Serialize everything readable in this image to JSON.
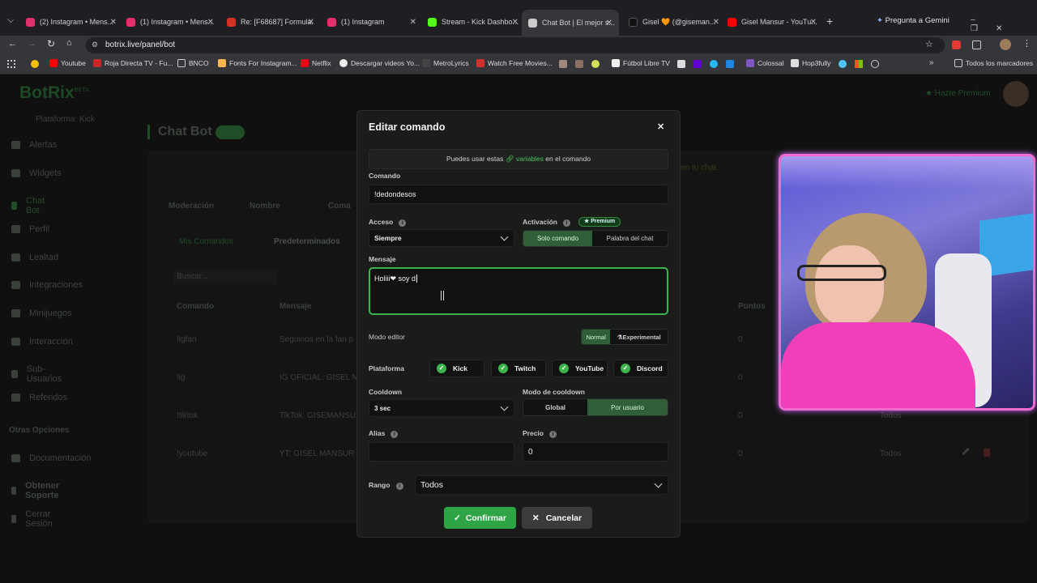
{
  "browser": {
    "tabs": [
      {
        "label": "(2) Instagram • Mens...",
        "color": "#e1306c"
      },
      {
        "label": "(1) Instagram • Mens...",
        "color": "#e1306c"
      },
      {
        "label": "Re: [F68687] Formula...",
        "color": "#d93025"
      },
      {
        "label": "(1) Instagram",
        "color": "#e1306c"
      },
      {
        "label": "Stream - Kick Dashbo...",
        "color": "#53fc18"
      },
      {
        "label": "Chat Bot | El mejor s...",
        "color": "#cccccc"
      },
      {
        "label": "Gisel 🧡 (@giseman...",
        "color": "#111111"
      },
      {
        "label": "Gisel Mansur - YouTu...",
        "color": "#ff0000"
      }
    ],
    "gemini": "Pregunta a Gemini",
    "url": "botrix.live/panel/bot",
    "bookmarks": [
      "Youtube",
      "Roja Directa TV - Fu...",
      "BNCO",
      "Fonts For Instagram...",
      "Netflix",
      "Descargar videos Yo...",
      "MetroLyrics",
      "Watch Free Movies...",
      "Fútbol Libre TV",
      "Colossal",
      "Hop3fully",
      "Todos los marcadores"
    ]
  },
  "app": {
    "logo": "BotRix",
    "beta": "BETA",
    "platform": "Plataforma: Kick",
    "premium": "Hazte Premium",
    "page_title": "Chat Bot",
    "sidebar": [
      "Alertas",
      "Widgets",
      "Chat Bot",
      "Perfil",
      "Lealtad",
      "Integraciones",
      "Minijuegos",
      "Interacción",
      "Sub-Usuarios",
      "Referidos"
    ],
    "otras": "Otras Opciones",
    "sidebar2": [
      "Documentación",
      "Obtener Soporte",
      "Cerrar Sesión"
    ],
    "tabs": [
      "Moderación",
      "Nombre",
      "Coma"
    ],
    "subtabs": [
      "Mis Comandos",
      "Predeterminados"
    ],
    "search": "Buscar...",
    "cols": [
      "Comando",
      "Mensaje",
      "Puntos"
    ],
    "rows": [
      {
        "cmd": "!lgfan",
        "msg": "Seguinos en la fan p",
        "pts": "0"
      },
      {
        "cmd": "!ig",
        "msg": "IG OFICIAL: GISEL M",
        "pts": "0"
      },
      {
        "cmd": "!tiktok",
        "msg": "TikTok: GISEMANSU",
        "pts": "0",
        "rank": "Todos"
      },
      {
        "cmd": "!youtube",
        "msg": "YT: GISEL MANSUR",
        "pts": "0",
        "rank": "Todos"
      }
    ],
    "hint": "en tu chat."
  },
  "modal": {
    "title": "Editar comando",
    "vars_pre": "Puedes usar estas",
    "vars_link": "variables",
    "vars_post": "en el comando",
    "comando_label": "Comando",
    "comando_value": "!dedondesos",
    "acceso_label": "Acceso",
    "acceso_value": "Siempre",
    "activacion_label": "Activación",
    "premium_badge": "Premium",
    "activacion_opts": [
      "Solo comando",
      "Palabra del chat"
    ],
    "mensaje_label": "Mensaje",
    "mensaje_value": "Holiii❤ soy d",
    "modo_label": "Modo editor",
    "modo_opts": [
      "Normal",
      "Experimental"
    ],
    "plataforma_label": "Plataforma",
    "plataformas": [
      "Kick",
      "Twitch",
      "YouTube",
      "Discord"
    ],
    "cooldown_label": "Cooldown",
    "cooldown_value": "3 sec",
    "modo_cd_label": "Modo de cooldown",
    "modo_cd_opts": [
      "Global",
      "Por usuario"
    ],
    "alias_label": "Alias",
    "alias_value": "",
    "precio_label": "Precio",
    "precio_value": "0",
    "rango_label": "Rango",
    "rango_value": "Todos",
    "confirm": "Confirmar",
    "cancel": "Cancelar"
  },
  "colors": {
    "accent": "#3db34d",
    "cam_border": "#f06ad0"
  }
}
